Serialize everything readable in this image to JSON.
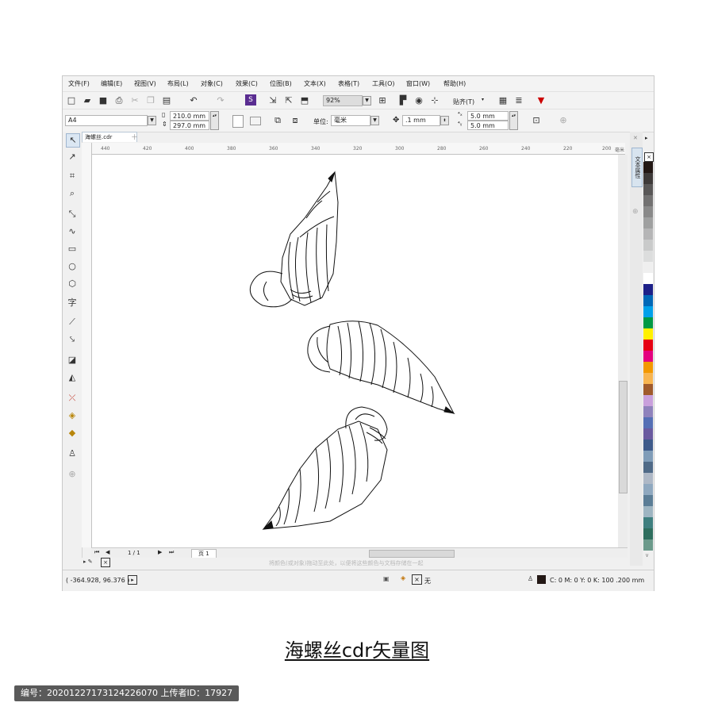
{
  "menu": [
    "文件(F)",
    "编辑(E)",
    "视图(V)",
    "布局(L)",
    "对象(C)",
    "效果(C)",
    "位图(B)",
    "文本(X)",
    "表格(T)",
    "工具(O)",
    "窗口(W)",
    "帮助(H)"
  ],
  "toolbar": {
    "zoom": "92%",
    "snap": "贴齐(T)"
  },
  "property_bar": {
    "page_size": "A4",
    "width": "210.0 mm",
    "height": "297.0 mm",
    "unit_label": "单位:",
    "unit": "毫米",
    "nudge": ".1 mm",
    "dup_x": "5.0 mm",
    "dup_y": "5.0 mm"
  },
  "document_tab": "海螺丝.cdr",
  "ruler_ticks": [
    "440",
    "420",
    "400",
    "380",
    "360",
    "340",
    "320",
    "300",
    "280",
    "260",
    "240",
    "220",
    "200"
  ],
  "ruler_unit": "毫米",
  "page_nav": {
    "count": "1 / 1",
    "page_tab": "页 1"
  },
  "color_hint": "将颜色(或对象)拖动至此处，以便将这些颜色与文档存储在一起",
  "status": {
    "coords": "( -364.928, 96.376 )",
    "fill_label": "无",
    "outline": "C: 0 M: 0 Y: 0 K: 100  .200 mm"
  },
  "dock_label": "文本属性",
  "palette": [
    "#231815",
    "#3e3a39",
    "#595757",
    "#727171",
    "#898989",
    "#9fa0a0",
    "#b5b5b6",
    "#c9caca",
    "#dcdddd",
    "#efefef",
    "#ffffff",
    "#1d2088",
    "#0068b7",
    "#00a0e9",
    "#009944",
    "#fff100",
    "#e60012",
    "#e4007f",
    "#f39800",
    "#f8b551",
    "#a05a2c",
    "#c9a0dc",
    "#8f82bc",
    "#556fb5",
    "#6a5a9f",
    "#3e5a8a",
    "#7f9cb8",
    "#4f6a87",
    "#aeb8c6",
    "#8fa8bf",
    "#5b7d96",
    "#9eb5c2",
    "#3f7f7f",
    "#2e6e5e",
    "#6c9a8b"
  ],
  "page_title": "海螺丝cdr矢量图",
  "meta": "编号：20201227173124226070 上传者ID：17927"
}
